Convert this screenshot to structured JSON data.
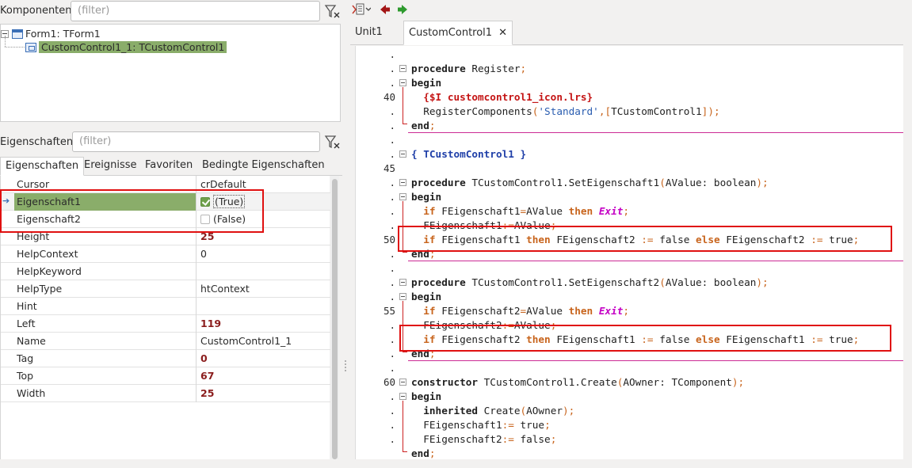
{
  "components": {
    "label": "Komponenten",
    "filter_placeholder": "(filter)",
    "tree": [
      {
        "label": "Form1: TForm1",
        "selected": false
      },
      {
        "label": "CustomControl1_1: TCustomControl1",
        "selected": true
      }
    ]
  },
  "properties": {
    "label": "Eigenschaften",
    "filter_placeholder": "(filter)",
    "tabs": [
      "Eigenschaften",
      "Ereignisse",
      "Favoriten",
      "Bedingte Eigenschaften"
    ],
    "active_tab": "Eigenschaften",
    "rows": [
      {
        "name": "Cursor",
        "value": "crDefault",
        "modified": false
      },
      {
        "name": "Eigenschaft1",
        "value": "(True)",
        "modified": false,
        "checkbox": true,
        "checked": true,
        "selected": true
      },
      {
        "name": "Eigenschaft2",
        "value": "(False)",
        "modified": false,
        "checkbox": true,
        "checked": false
      },
      {
        "name": "Height",
        "value": "25",
        "modified": true
      },
      {
        "name": "HelpContext",
        "value": "0",
        "modified": false
      },
      {
        "name": "HelpKeyword",
        "value": "",
        "modified": false
      },
      {
        "name": "HelpType",
        "value": "htContext",
        "modified": false
      },
      {
        "name": "Hint",
        "value": "",
        "modified": false
      },
      {
        "name": "Left",
        "value": "119",
        "modified": true
      },
      {
        "name": "Name",
        "value": "CustomControl1_1",
        "modified": false
      },
      {
        "name": "Tag",
        "value": "0",
        "modified": true
      },
      {
        "name": "Top",
        "value": "67",
        "modified": true
      },
      {
        "name": "Width",
        "value": "25",
        "modified": true
      }
    ]
  },
  "editor": {
    "tabs": [
      {
        "label": "Unit1",
        "active": false
      },
      {
        "label": "CustomControl1",
        "active": true,
        "close": "✕"
      }
    ],
    "gutter": [
      ".",
      ".",
      ".",
      "40",
      ".",
      ".",
      ".",
      ".",
      "45",
      ".",
      ".",
      ".",
      ".",
      "50",
      ".",
      ".",
      ".",
      ".",
      "55",
      ".",
      ".",
      ".",
      ".",
      "60",
      ".",
      ".",
      ".",
      "."
    ],
    "code": [
      "",
      "procedure Register;",
      "begin",
      "  {$I customcontrol1_icon.lrs}",
      "  RegisterComponents('Standard',[TCustomControl1]);",
      "end;",
      "",
      "{ TCustomControl1 }",
      "",
      "procedure TCustomControl1.SetEigenschaft1(AValue: boolean);",
      "begin",
      "  if FEigenschaft1=AValue then Exit;",
      "  FEigenschaft1:=AValue;",
      "  if FEigenschaft1 then FEigenschaft2 := false else FEigenschaft2 := true;",
      "end;",
      "",
      "procedure TCustomControl1.SetEigenschaft2(AValue: boolean);",
      "begin",
      "  if FEigenschaft2=AValue then Exit;",
      "  FEigenschaft2:=AValue;",
      "  if FEigenschaft2 then FEigenschaft1 := false else FEigenschaft1 := true;",
      "end;",
      "",
      "constructor TCustomControl1.Create(AOwner: TComponent);",
      "begin",
      "  inherited Create(AOwner);",
      "  FEigenschaft1:= true;",
      "  FEigenschaft2:= false;",
      "end;"
    ]
  },
  "colors": {
    "selection": "#8aad6a",
    "highlight_box": "#e01010",
    "keyword_operator": "#c8641c",
    "string": "#2a5db0",
    "directive": "#c41414",
    "exit_keyword": "#c400c4"
  }
}
